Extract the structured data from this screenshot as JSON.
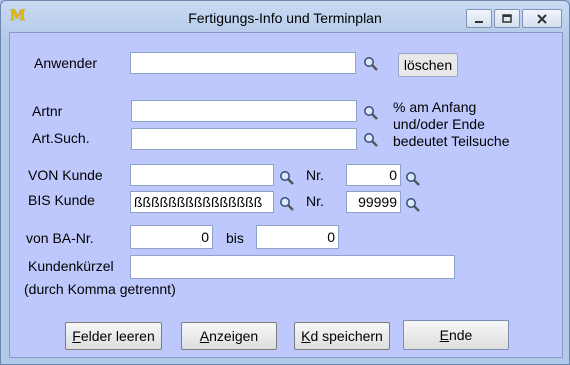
{
  "window": {
    "title": "Fertigungs-Info und Terminplan",
    "app_icon": "M",
    "min_icon": "minimize-icon",
    "max_icon": "maximize-icon",
    "close_icon": "close-icon"
  },
  "form": {
    "anwender_label": "Anwender",
    "anwender_value": "",
    "loeschen_label": "löschen",
    "artnr_label": "Artnr",
    "artnr_value": "",
    "artsuch_label": "Art.Such.",
    "artsuch_value": "",
    "hint_line1": "% am Anfang",
    "hint_line2": "und/oder Ende",
    "hint_line3": "bedeutet Teilsuche",
    "von_kunde_label": "VON Kunde",
    "von_kunde_value": "",
    "von_nr_label": "Nr.",
    "von_nr_value": "0",
    "bis_kunde_label": "BIS Kunde",
    "bis_kunde_value": "ßßßßßßßßßßßßßßß",
    "bis_nr_label": "Nr.",
    "bis_nr_value": "99999",
    "von_ba_label": "von BA-Nr.",
    "von_ba_value": "0",
    "bis_label": "bis",
    "bis_ba_value": "0",
    "kuerzel_label": "Kundenkürzel",
    "kuerzel_sub": "(durch Komma getrennt)",
    "kuerzel_value": ""
  },
  "buttons": {
    "felder_first": "F",
    "felder_rest": "elder leeren",
    "anzeigen_first": "A",
    "anzeigen_rest": "nzeigen",
    "kd_first": "K",
    "kd_rest": "d speichern",
    "ende_first": "E",
    "ende_rest": "nde"
  }
}
